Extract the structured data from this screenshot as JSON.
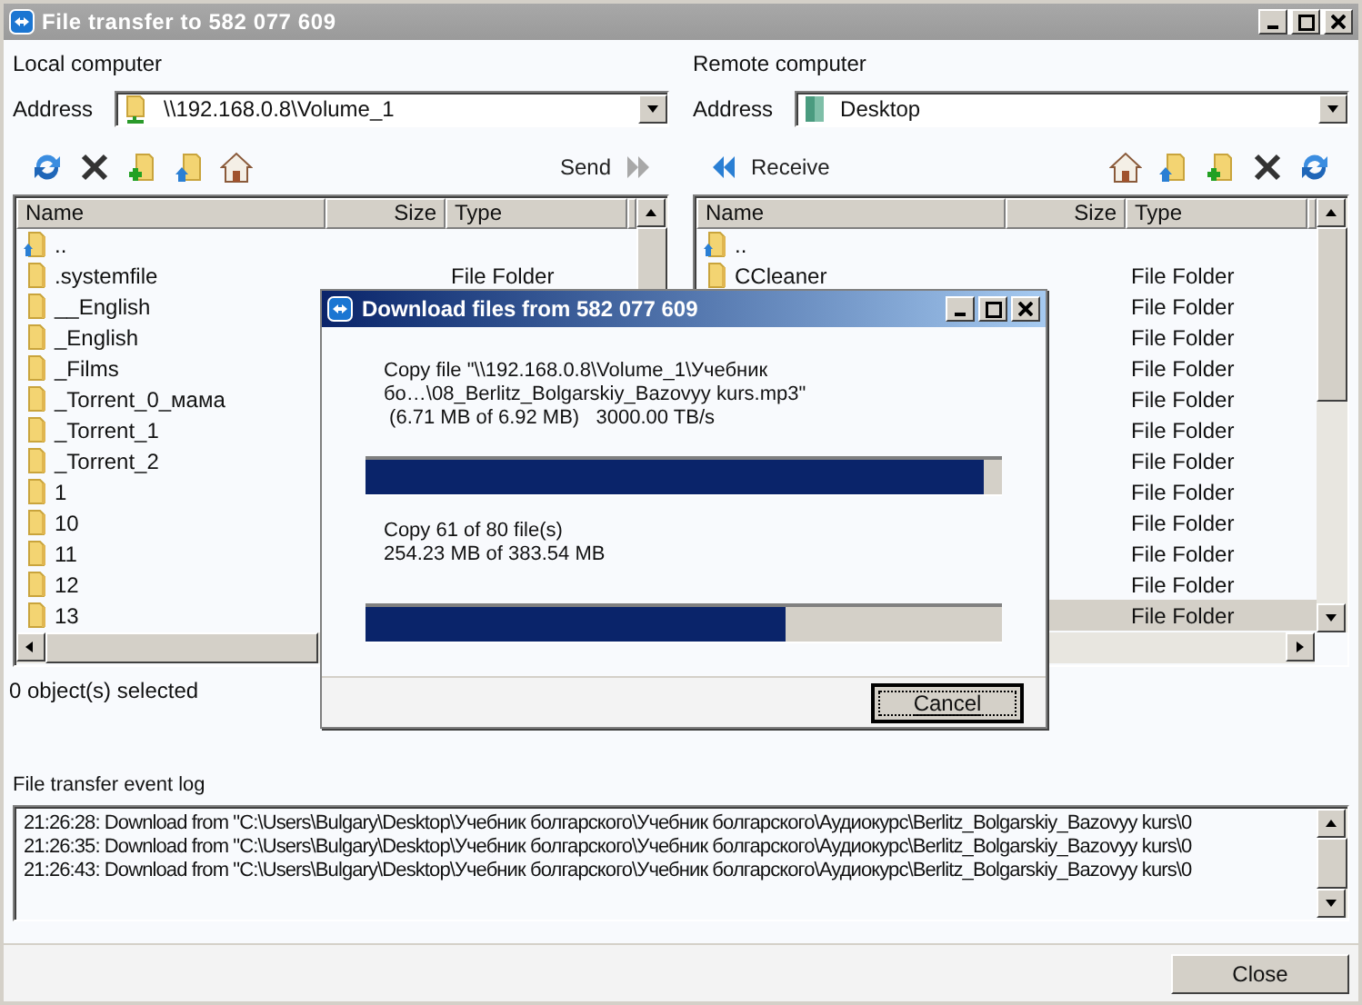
{
  "window": {
    "title": "File transfer to 582 077 609",
    "controls": [
      {
        "kind": "minimize"
      },
      {
        "kind": "maximize"
      },
      {
        "kind": "close"
      }
    ]
  },
  "panels": [
    {
      "label": "Local computer",
      "address_label": "Address",
      "address": {
        "kind": "network-folder",
        "value": "\\\\192.168.0.8\\Volume_1"
      },
      "toolbar": [
        {
          "kind": "refresh"
        },
        {
          "kind": "delete"
        },
        {
          "kind": "new-folder"
        },
        {
          "kind": "folder-up"
        },
        {
          "kind": "home"
        },
        {
          "kind": "send",
          "label": "Send"
        }
      ],
      "columns": [
        "Name",
        "Size",
        "Type"
      ],
      "rows": [
        {
          "kind": "parent",
          "name": "..",
          "selected": false
        },
        {
          "kind": "folder",
          "name": ".systemfile",
          "type": "File Folder",
          "selected": false
        },
        {
          "kind": "folder",
          "name": "__English",
          "selected": false
        },
        {
          "kind": "folder",
          "name": "_English",
          "selected": false
        },
        {
          "kind": "folder",
          "name": "_Films",
          "selected": false
        },
        {
          "kind": "folder",
          "name": "_Torrent_0_мама",
          "selected": false
        },
        {
          "kind": "folder",
          "name": "_Torrent_1",
          "selected": false
        },
        {
          "kind": "folder",
          "name": "_Torrent_2",
          "selected": false
        },
        {
          "kind": "folder",
          "name": "1",
          "selected": false
        },
        {
          "kind": "folder",
          "name": "10",
          "selected": false
        },
        {
          "kind": "folder",
          "name": "11",
          "selected": false
        },
        {
          "kind": "folder",
          "name": "12",
          "selected": false
        },
        {
          "kind": "folder",
          "name": "13",
          "selected": false
        }
      ],
      "status": "0 object(s) selected"
    },
    {
      "label": "Remote computer",
      "address_label": "Address",
      "address": {
        "kind": "desktop",
        "value": "Desktop"
      },
      "toolbar": [
        {
          "kind": "receive",
          "label": "Receive"
        },
        {
          "kind": "home"
        },
        {
          "kind": "folder-up"
        },
        {
          "kind": "new-folder"
        },
        {
          "kind": "delete"
        },
        {
          "kind": "refresh"
        }
      ],
      "columns": [
        "Name",
        "Size",
        "Type"
      ],
      "rows": [
        {
          "kind": "parent",
          "name": "..",
          "selected": false
        },
        {
          "kind": "folder",
          "name": "CCleaner",
          "type": "File Folder",
          "selected": false
        },
        {
          "type": "File Folder",
          "selected": false
        },
        {
          "type": "File Folder",
          "selected": false
        },
        {
          "type": "File Folder",
          "selected": false
        },
        {
          "type": "File Folder",
          "selected": false
        },
        {
          "type": "File Folder",
          "selected": false
        },
        {
          "type": "File Folder",
          "selected": false
        },
        {
          "type": "File Folder",
          "selected": false
        },
        {
          "type": "File Folder",
          "selected": false
        },
        {
          "type": "File Folder",
          "selected": false
        },
        {
          "type": "File Folder",
          "selected": false
        },
        {
          "type": "File Folder",
          "selected": true
        }
      ]
    }
  ],
  "event_log": {
    "label": "File transfer event log",
    "lines": [
      "21:26:28: Download from \"C:\\Users\\Bulgary\\Desktop\\Учебник болгарского\\Учебник болгарского\\Аудиокурс\\Berlitz_Bolgarskiy_Bazovyy kurs\\0",
      "21:26:35: Download from \"C:\\Users\\Bulgary\\Desktop\\Учебник болгарского\\Учебник болгарского\\Аудиокурс\\Berlitz_Bolgarskiy_Bazovyy kurs\\0",
      "21:26:43: Download from \"C:\\Users\\Bulgary\\Desktop\\Учебник болгарского\\Учебник болгарского\\Аудиокурс\\Berlitz_Bolgarskiy_Bazovyy kurs\\0"
    ]
  },
  "close_button": "Close",
  "dialog": {
    "title": "Download files from 582 077 609",
    "controls": [
      {
        "kind": "minimize"
      },
      {
        "kind": "maximize"
      },
      {
        "kind": "close"
      }
    ],
    "file_lines": [
      "Copy file \"\\\\192.168.0.8\\Volume_1\\Учебник",
      "бо…\\08_Berlitz_Bolgarskiy_Bazovyy kurs.mp3\"",
      " (6.71 MB of 6.92 MB)   3000.00 TB/s"
    ],
    "file_progress": {
      "level": 0.97
    },
    "total_lines": [
      "Copy 61 of 80 file(s)",
      "254.23 MB of 383.54 MB"
    ],
    "total_progress": {
      "level": 0.66
    },
    "cancel_button": "Cancel"
  }
}
